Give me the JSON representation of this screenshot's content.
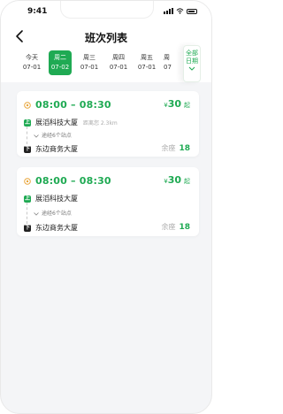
{
  "status": {
    "time": "9:41"
  },
  "header": {
    "title": "班次列表"
  },
  "dates": [
    {
      "weekday": "今天",
      "date": "07-01",
      "active": false
    },
    {
      "weekday": "周二",
      "date": "07-02",
      "active": true
    },
    {
      "weekday": "周三",
      "date": "07-01",
      "active": false
    },
    {
      "weekday": "周四",
      "date": "07-01",
      "active": false
    },
    {
      "weekday": "周五",
      "date": "07-01",
      "active": false
    },
    {
      "weekday": "周",
      "date": "07",
      "active": false
    }
  ],
  "all_dates": {
    "line1": "全部",
    "line2": "日期"
  },
  "trips": [
    {
      "time": "08:00 – 08:30",
      "price_symbol": "¥",
      "price": "30",
      "price_unit": "起",
      "board": {
        "badge": "上",
        "name": "展滔科技大厦",
        "distance": "距离您 2.3km"
      },
      "via": "途经6个站点",
      "alight": {
        "badge": "下",
        "name": "东边商务大厦"
      },
      "seats_label": "余座",
      "seats": "18"
    },
    {
      "time": "08:00 – 08:30",
      "price_symbol": "¥",
      "price": "30",
      "price_unit": "起",
      "board": {
        "badge": "上",
        "name": "展滔科技大厦",
        "distance": ""
      },
      "via": "途经6个站点",
      "alight": {
        "badge": "下",
        "name": "东边商务大厦"
      },
      "seats_label": "余座",
      "seats": "18"
    }
  ],
  "colors": {
    "accent": "#1faa53",
    "background": "#f4f5f7"
  },
  "icons": [
    "back-arrow-icon",
    "clock-icon",
    "chevron-down-icon",
    "signal-icon",
    "wifi-icon",
    "battery-icon"
  ]
}
